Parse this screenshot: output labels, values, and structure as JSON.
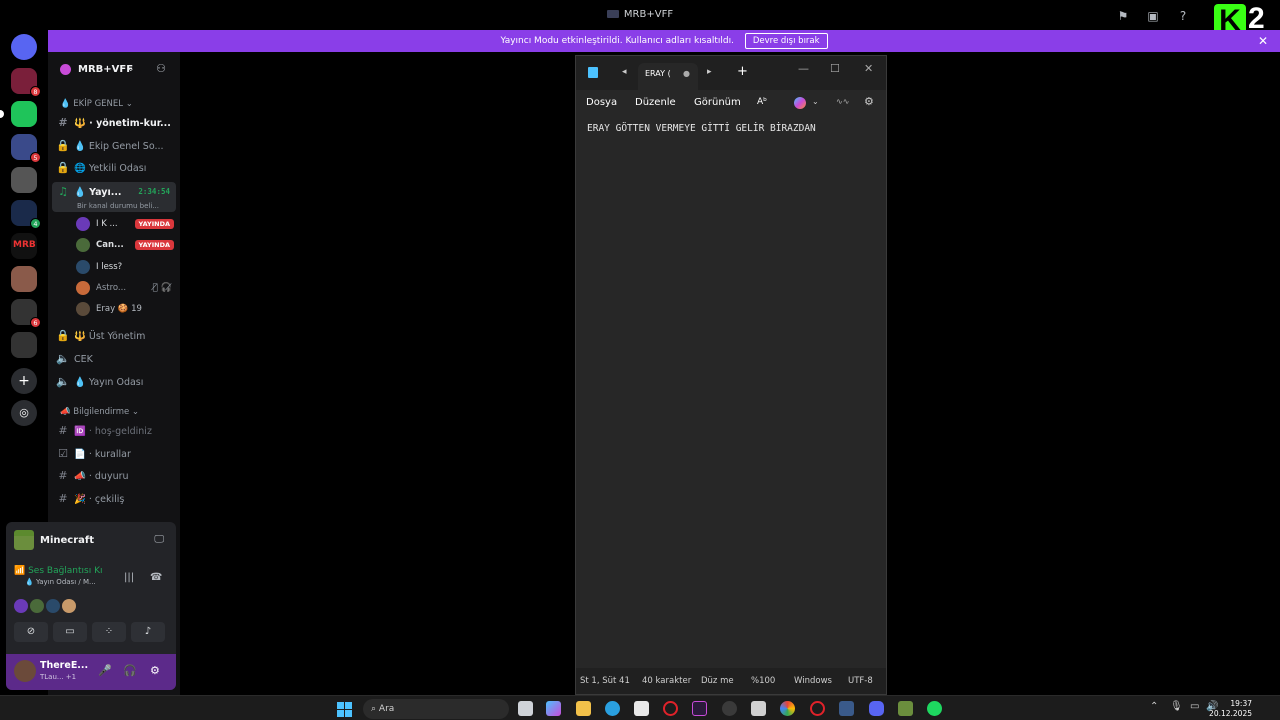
{
  "window": {
    "title": "MRB+VFF"
  },
  "banner": {
    "text": "Yayıncı Modu etkinleştirildi. Kullanıcı adları kısaltıldı.",
    "button": "Devre dışı bırak"
  },
  "overlay": {
    "logo_letter": "K",
    "logo_number": "2"
  },
  "guilds": [
    {
      "badge": "8"
    },
    {
      "badge": ""
    },
    {
      "badge": "5"
    },
    {
      "badge": ""
    },
    {
      "badge": "4"
    },
    {
      "badge": ""
    },
    {
      "badge": ""
    },
    {
      "badge": "6"
    },
    {
      "badge": ""
    }
  ],
  "server": {
    "name": "MRB+VFF"
  },
  "categories": {
    "ekip": "EKİP GENEL",
    "bilgi": "Bilgilendirme"
  },
  "channels": {
    "yonetim": "yönetim-kur...",
    "ekip_sohbet": "Ekip Genel So...",
    "yetkili": "Yetkili Odası",
    "yayin_active": "Yayı...",
    "yayin_time": "2:34:54",
    "yayin_status": "Bir kanal durumu beli...",
    "ust": "Üst Yönetim",
    "cek": "CEK",
    "yayin_odasi": "Yayın Odası",
    "hos": "hoş-geldiniz",
    "kurallar": "kurallar",
    "duyuru": "duyuru",
    "cekilis": "çekiliş"
  },
  "voice_users": [
    {
      "name": "I K ...",
      "live": "YAYINDA"
    },
    {
      "name": "Can...",
      "live": "YAYINDA"
    },
    {
      "name": "I less?",
      "live": ""
    },
    {
      "name": "Astro...",
      "live": ""
    },
    {
      "name": "Eray 🍪 19",
      "live": ""
    }
  ],
  "panel": {
    "game": "Minecraft",
    "voice_status": "Ses Bağlantısı Kı",
    "voice_sub": "Yayın Odası / M..."
  },
  "user": {
    "name": "ThereE...",
    "status": "TLau... +1"
  },
  "notepad": {
    "tab": "ERAY (",
    "menu": {
      "file": "Dosya",
      "edit": "Düzenle",
      "view": "Görünüm"
    },
    "content": "ERAY GÖTTEN VERMEYE GİTTİ GELİR BİRAZDAN",
    "status": {
      "position": "St 1, Süt 41",
      "chars": "40 karakter",
      "mode": "Düz me",
      "zoom": "%100",
      "eol": "Windows",
      "encoding": "UTF-8"
    }
  },
  "taskbar": {
    "search": "Ara",
    "time": "19:37",
    "date": "20.12.2025"
  },
  "colors": {
    "accent": "#8a3ee8",
    "live": "#da373c",
    "online": "#23a55a"
  }
}
